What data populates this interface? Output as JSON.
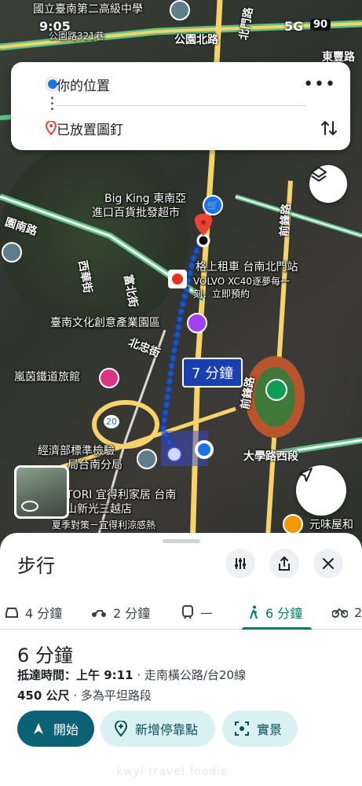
{
  "status_bar": {
    "time": "9:05",
    "network": "5G",
    "battery": "90"
  },
  "route_inputs": {
    "origin": "你的位置",
    "destination": "已放置圖釘",
    "more": "•••"
  },
  "map": {
    "places": {
      "school": "國立臺南第二高級中學",
      "address_top": "公園路321巷",
      "supermarket_1": "Big King 東南亞",
      "supermarket_2": "進口百貨批發超市",
      "car_rental_1": "格上租車 台南北門站",
      "car_rental_2": "VOLVO XC40逐夢每一",
      "car_rental_3": "刻．立即預約",
      "culture_park": "臺南文化創意產業園區",
      "hostel": "嵐茵鐵道旅館",
      "bureau_1": "經濟部標準檢驗",
      "bureau_2": "局台南分局",
      "store_1": "TORI 宜得利家居 台南",
      "store_2": "山新光三越店",
      "store_3": "夏季對策－宜得利涼感熱",
      "restaurant": "元味屋和",
      "road_number": "20"
    },
    "roads": {
      "park_north": "公園北路",
      "beimen": "北門路",
      "dongfeng": "東豐路",
      "yuanlin": "園南路",
      "ximen": "西華街",
      "fuxing": "富北街",
      "beizhong": "北忠街",
      "qianfeng": "前鋒路",
      "qianfeng2": "前鋒路",
      "daxue": "大學路西段"
    },
    "walk_duration_badge": "7 分鐘"
  },
  "sheet": {
    "title": "步行",
    "modes": [
      {
        "icon": "car-icon",
        "label": "4 分鐘"
      },
      {
        "icon": "motorcycle-icon",
        "label": "2 分鐘"
      },
      {
        "icon": "train-icon",
        "label": "—"
      },
      {
        "icon": "walk-icon",
        "label": "6 分鐘",
        "active": true
      },
      {
        "icon": "bicycle-icon",
        "label": "2"
      }
    ],
    "duration": "6 分鐘",
    "arrival_label": "抵達時間：",
    "arrival_value": "上午 9:11",
    "via": "· 走南橫公路/台20線",
    "distance": "450 公尺",
    "terrain": "· 多為平坦路段",
    "start_button": "開始",
    "add_stop_button": "新增停靠點",
    "live_view_button": "實景"
  },
  "watermark": "kwyi  travel.foodie",
  "colors": {
    "accent_teal": "#00796b",
    "start_button": "#0b6275",
    "route_blue": "#1a73e8",
    "pin_red": "#ea4335"
  }
}
